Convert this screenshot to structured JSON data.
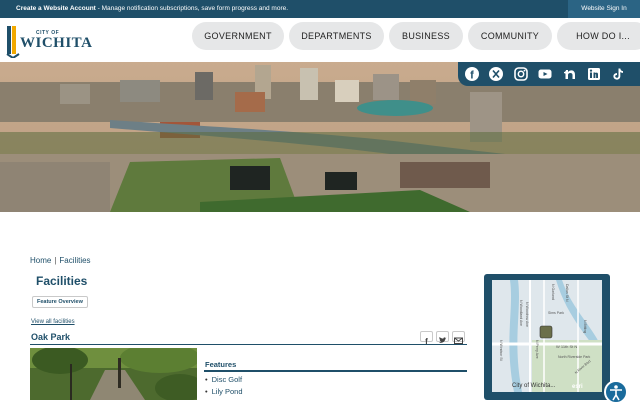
{
  "topbar": {
    "link": "Create a Website Account",
    "message": " - Manage notification subscriptions, save form progress and more.",
    "signin": "Website Sign In"
  },
  "logo": {
    "city_of": "CITY OF",
    "name": "WICHITA"
  },
  "nav": [
    {
      "label": "GOVERNMENT"
    },
    {
      "label": "DEPARTMENTS"
    },
    {
      "label": "BUSINESS"
    },
    {
      "label": "COMMUNITY"
    },
    {
      "label": "HOW DO I..."
    }
  ],
  "social": [
    "facebook-icon",
    "x-icon",
    "instagram-icon",
    "youtube-icon",
    "nextdoor-icon",
    "linkedin-icon",
    "tiktok-icon"
  ],
  "breadcrumb": {
    "home": "Home",
    "separator": "|",
    "current": "Facilities"
  },
  "page": {
    "title": "Facilities",
    "feature_overview": "Feature Overview",
    "view_all": "View all facilities",
    "item_title": "Oak Park",
    "features_heading": "Features",
    "features": [
      "Disc Golf",
      "Lily Pond"
    ]
  },
  "map": {
    "caption": "City of Wichita...",
    "streets": [
      "N Woodland Ave",
      "N Perry Ave",
      "N Woodrow Ave",
      "W 11th St N",
      "Sims Park",
      "N Garland",
      "N Windsor St",
      "Dallas St N",
      "N River Blvd",
      "N Bitting",
      "North Riverside Park",
      "esri"
    ]
  },
  "colors": {
    "brand": "#1f4f69",
    "nav_pill": "#e6e7e8",
    "accessibility": "#1a6b9c"
  }
}
